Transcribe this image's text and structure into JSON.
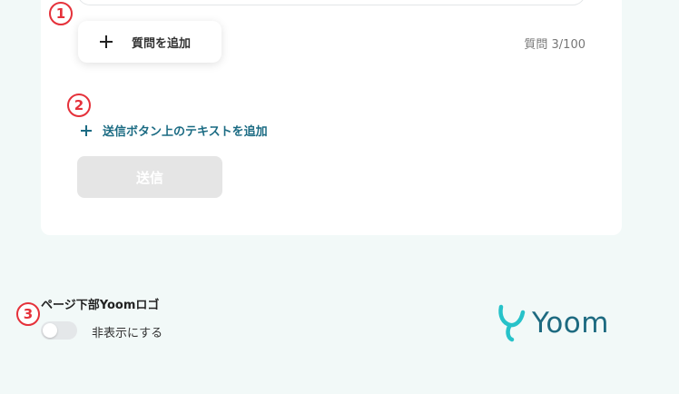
{
  "form": {
    "add_question_label": "質問を追加",
    "question_count": "質問 3/100",
    "add_submit_text_label": "送信ボタン上のテキストを追加",
    "submit_label": "送信"
  },
  "annotations": {
    "badge1": "1",
    "badge2": "2",
    "badge3": "3"
  },
  "logo_setting": {
    "title": "ページ下部Yoomロゴ",
    "toggle_label": "非表示にする",
    "toggle_on": false
  },
  "brand": {
    "name": "Yoom",
    "color": "#1d6a80",
    "accent": "#27c2c9"
  }
}
